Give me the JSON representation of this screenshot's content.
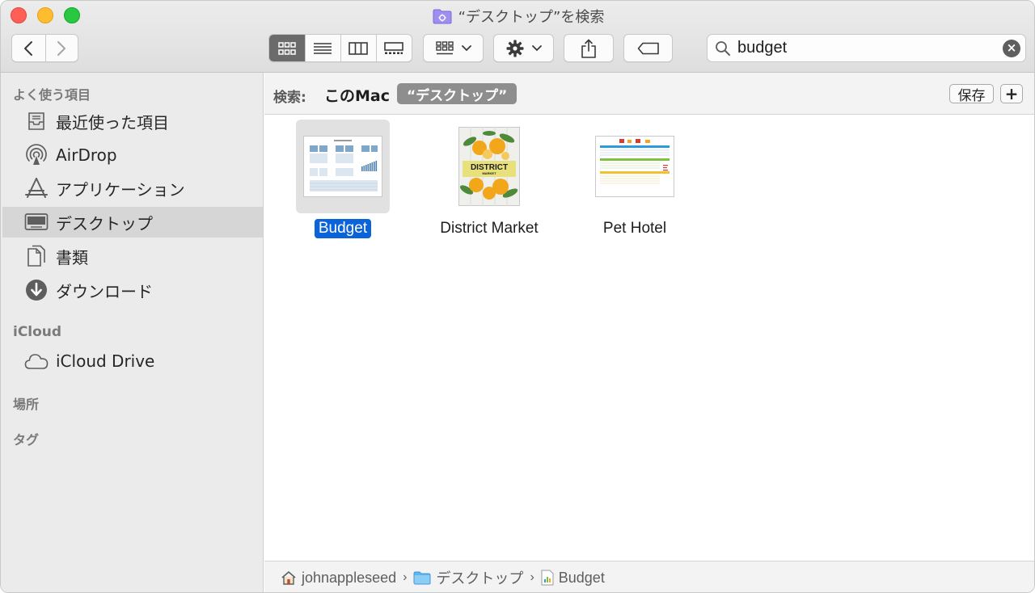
{
  "window": {
    "title": "“デスクトップ”を検索"
  },
  "toolbar": {
    "back_icon": "chevron-left-icon",
    "forward_icon": "chevron-right-icon",
    "views": [
      {
        "name": "icon-view",
        "active": true
      },
      {
        "name": "list-view",
        "active": false
      },
      {
        "name": "column-view",
        "active": false
      },
      {
        "name": "gallery-view",
        "active": false
      }
    ],
    "search_value": "budget"
  },
  "sidebar": {
    "favorites_header": "よく使う項目",
    "favorites": [
      {
        "label": "最近使った項目",
        "icon": "recents-icon"
      },
      {
        "label": "AirDrop",
        "icon": "airdrop-icon"
      },
      {
        "label": "アプリケーション",
        "icon": "applications-icon"
      },
      {
        "label": "デスクトップ",
        "icon": "desktop-icon",
        "selected": true
      },
      {
        "label": "書類",
        "icon": "documents-icon"
      },
      {
        "label": "ダウンロード",
        "icon": "downloads-icon"
      }
    ],
    "icloud_header": "iCloud",
    "icloud": [
      {
        "label": "iCloud Drive",
        "icon": "cloud-icon"
      }
    ],
    "locations_header": "場所",
    "tags_header": "タグ"
  },
  "scope": {
    "label": "検索:",
    "this_mac": "このMac",
    "desktop": "“デスクトップ”",
    "save": "保存",
    "add": "+"
  },
  "files": [
    {
      "name": "Budget",
      "selected": true,
      "kind": "spreadsheet"
    },
    {
      "name": "District Market",
      "selected": false,
      "kind": "poster"
    },
    {
      "name": "Pet Hotel",
      "selected": false,
      "kind": "table"
    }
  ],
  "thumb_text": {
    "poster_title": "DISTRICT",
    "poster_sub": "MARKET"
  },
  "pathbar": {
    "segments": [
      "johnappleseed",
      "デスクトップ",
      "Budget"
    ],
    "separator": "›"
  },
  "colors": {
    "selection": "#0a63d8",
    "close": "#fe5f57",
    "minimize": "#febc2e",
    "maximize": "#28c840"
  }
}
